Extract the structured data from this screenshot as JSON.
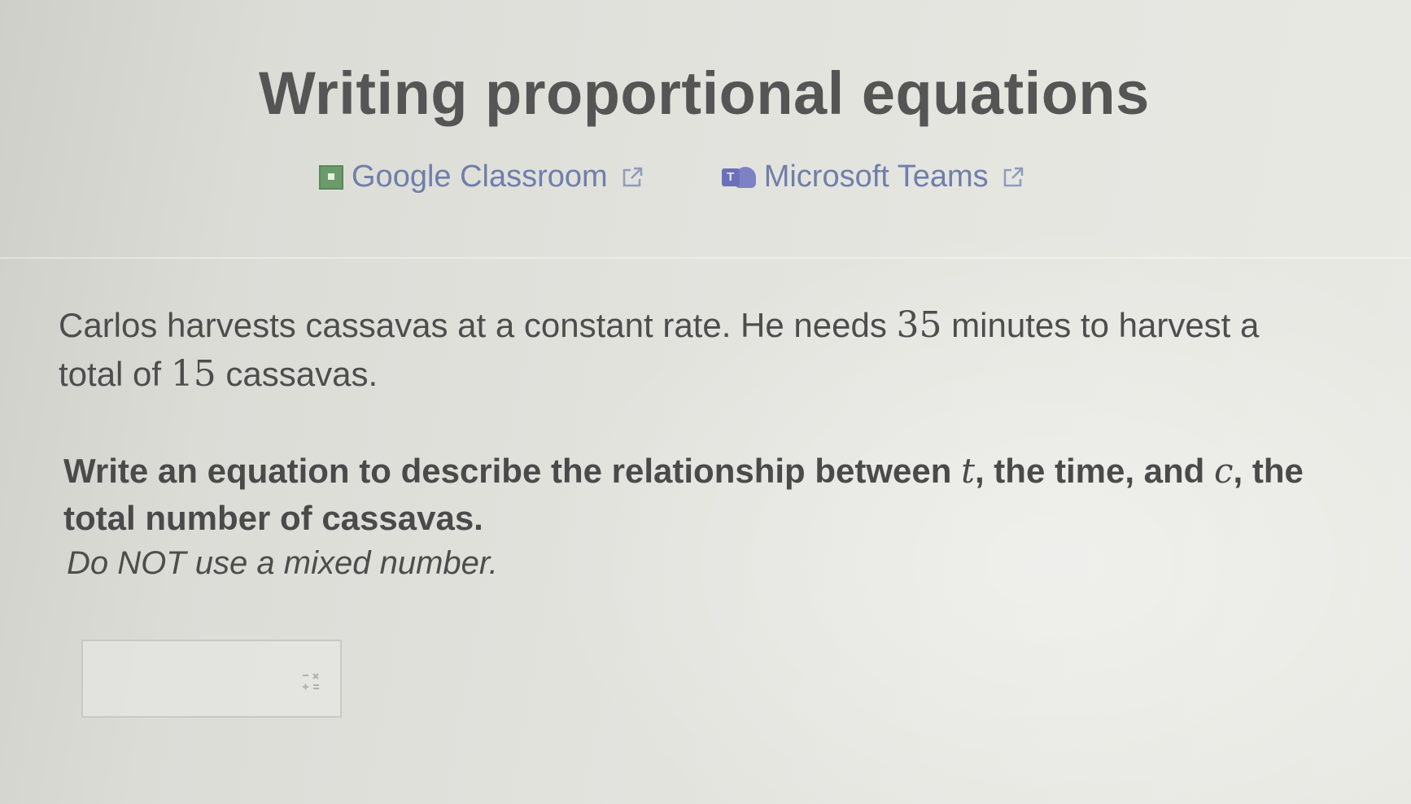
{
  "page": {
    "title": "Writing proportional equations"
  },
  "share": {
    "google_classroom_label": "Google Classroom",
    "microsoft_teams_label": "Microsoft Teams",
    "google_icon": "google-classroom-icon",
    "teams_icon": "microsoft-teams-icon",
    "external_icon": "external-link-icon"
  },
  "problem": {
    "part1": "Carlos harvests cassavas at a constant rate. He needs ",
    "minutes": "35",
    "part2": " minutes to harvest a total of ",
    "total": "15",
    "part3": " cassavas."
  },
  "question": {
    "part1": "Write an equation to describe the relationship between ",
    "var_t": "t",
    "part2": ", the time, and ",
    "var_c": "c",
    "part3": ", the total number of cassavas."
  },
  "note": "Do NOT use a mixed number.",
  "answer": {
    "value": "",
    "keypad_icon": "math-keypad-icon"
  },
  "colors": {
    "link": "#6f7faa",
    "title": "#555555",
    "text": "#4d4d4d"
  }
}
